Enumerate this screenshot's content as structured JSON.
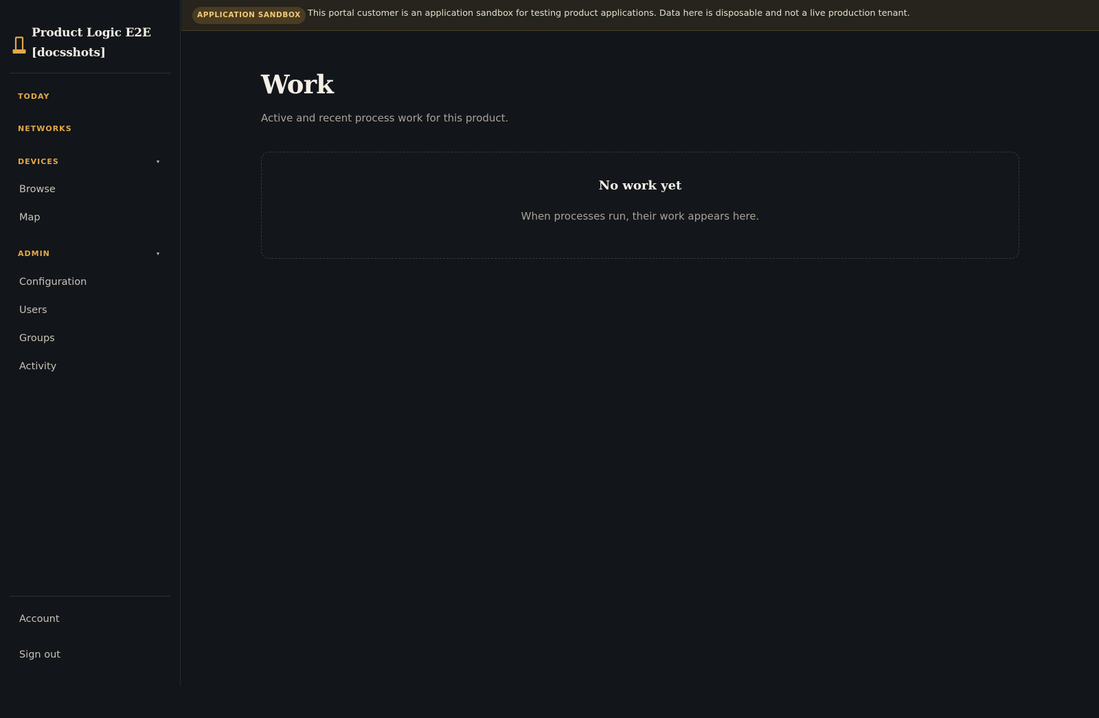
{
  "banner": {
    "badge": "APPLICATION SANDBOX",
    "message": "This portal customer is an application sandbox for testing product applications. Data here is disposable and not a live production tenant."
  },
  "sidebar": {
    "brand_title": "Product Logic E2E [docsshots]",
    "brand_icon": "device-icon",
    "sections": {
      "today": "TODAY",
      "networks": "NETWORKS",
      "devices": "DEVICES",
      "admin": "ADMIN"
    },
    "chevron": "▾",
    "devices_items": [
      "Browse",
      "Map"
    ],
    "admin_items": [
      "Configuration",
      "Users",
      "Groups",
      "Activity"
    ],
    "footer_items": [
      "Account",
      "Sign out"
    ]
  },
  "main": {
    "title": "Work",
    "subtitle": "Active and recent process work for this product.",
    "empty_state": {
      "title": "No work yet",
      "text": "When processes run, their work appears here."
    }
  },
  "colors": {
    "background": "#12151a",
    "accent": "#e3a84a",
    "banner_bg": "#26241c",
    "text_primary": "#f4efe6",
    "text_muted": "#a9a398"
  }
}
